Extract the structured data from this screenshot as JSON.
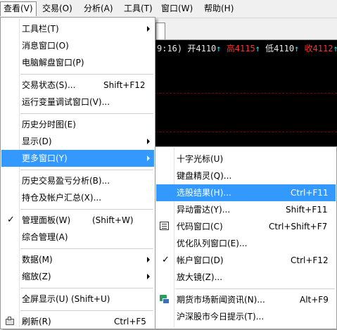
{
  "menubar": {
    "items": [
      "查看(V)",
      "交易(O)",
      "分析(A)",
      "工具(T)",
      "窗口(W)",
      "帮助(H)"
    ]
  },
  "quote": {
    "time": "9:16)",
    "open_label": "开",
    "open_value": "4110",
    "high_label": "高",
    "high_value": "4115",
    "low_label": "低",
    "low_value": "4110",
    "close_label": "收",
    "close_value": "4112",
    "arrow": "↑"
  },
  "main_menu": {
    "toolbar": "工具栏(T)",
    "message_window": "消息窗口(O)",
    "pc_unlock_window": "电脑解盘窗口(P)",
    "trade_status": "交易状态(S)...",
    "trade_status_shortcut": "Shift+F12",
    "var_debug_window": "运行变量调试窗口(V)...",
    "history_intraday": "历史分时图(E)",
    "display": "显示(D)",
    "more_windows": "更多窗口(Y)",
    "history_pnl": "历史交易盈亏分析(B)...",
    "position_summary": "持仓及帐户汇总(X)...",
    "management_panel": "管理面板(W)",
    "management_panel_shortcut": "(Shift+W)",
    "general_management": "综合管理(A)",
    "data": "数据(M)",
    "zoom": "缩放(Z)",
    "fullscreen": "全屏显示(U) (Shift+U)",
    "refresh": "刷新(R)",
    "refresh_shortcut": "Ctrl+F5",
    "check_mark": "✓"
  },
  "sub_menu": {
    "crosshair": "十字光标(U)",
    "keyboard_wizard": "键盘精灵(Q)...",
    "stock_picker_results": "选股结果(H)...",
    "stock_picker_results_shortcut": "Ctrl+F11",
    "anomaly_radar": "异动雷达(Y)...",
    "anomaly_radar_shortcut": "Shift+F11",
    "code_window": "代码窗口(C)",
    "code_window_shortcut": "Ctrl+Shift+F7",
    "optimized_queue_window": "优化队列窗口(E)...",
    "account_window": "帐户窗口(D)",
    "account_window_shortcut": "Ctrl+F12",
    "magnifier": "放大镜(Z)...",
    "futures_news": "期货市场新闻资讯(N)...",
    "futures_news_shortcut": "Alt+F9",
    "shsz_today_tips": "沪深股市今日提示(T)...",
    "check_mark": "✓"
  }
}
